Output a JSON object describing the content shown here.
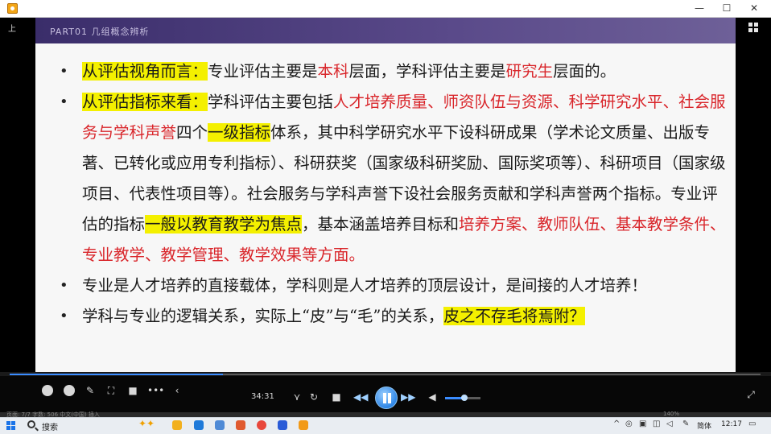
{
  "window": {
    "minimize_glyph": "—",
    "maximize_glyph": "☐",
    "close_glyph": "✕"
  },
  "player": {
    "left_label": "上",
    "time": "34:31"
  },
  "slide": {
    "header": "PART01  几组概念辨析",
    "bullets": [
      {
        "segments": [
          {
            "t": "从评估视角而言：",
            "s": "hl"
          },
          {
            "t": "专业评估主要是",
            "s": ""
          },
          {
            "t": "本科",
            "s": "red"
          },
          {
            "t": "层面，学科评估主要是",
            "s": ""
          },
          {
            "t": "研究生",
            "s": "red"
          },
          {
            "t": "层面的。",
            "s": ""
          }
        ]
      },
      {
        "segments": [
          {
            "t": "从评估指标来看：",
            "s": "hl"
          },
          {
            "t": "学科评估主要包括",
            "s": ""
          },
          {
            "t": "人才培养质量、师资队伍与资源、科学研究水平、社会服务与学科声誉",
            "s": "red"
          },
          {
            "t": "四个",
            "s": ""
          },
          {
            "t": "一级指标",
            "s": "hl"
          },
          {
            "t": "体系，其中科学研究水平下设科研成果（学术论文质量、出版专著、已转化或应用专利指标）、科研获奖（国家级科研奖励、国际奖项等）、科研项目（国家级项目、代表性项目等）。社会服务与学科声誉下设社会服务贡献和学科声誉两个指标。专业评估的指标",
            "s": ""
          },
          {
            "t": "一般以教育教学为焦点",
            "s": "hl"
          },
          {
            "t": "，基本涵盖培养目标和",
            "s": ""
          },
          {
            "t": "培养方案、教师队伍、基本教学条件、专业教学、教学管理、教学效果等方面。",
            "s": "red"
          }
        ]
      },
      {
        "segments": [
          {
            "t": "专业是人才培养的直接载体，学科则是人才培养的顶层设计，是间接的人才培养！",
            "s": ""
          }
        ]
      },
      {
        "segments": [
          {
            "t": "学科与专业的逻辑关系，实际上“皮”与“毛”的关系，",
            "s": ""
          },
          {
            "t": "皮之不存毛将焉附？",
            "s": "hl"
          }
        ]
      }
    ]
  },
  "statusbar": {
    "left": "页面: 7/7   字数: 506   中文(中国)   插入",
    "zoom": "140%"
  },
  "taskbar": {
    "search_label": "搜索",
    "ime": "简体",
    "clock": "12:17"
  }
}
